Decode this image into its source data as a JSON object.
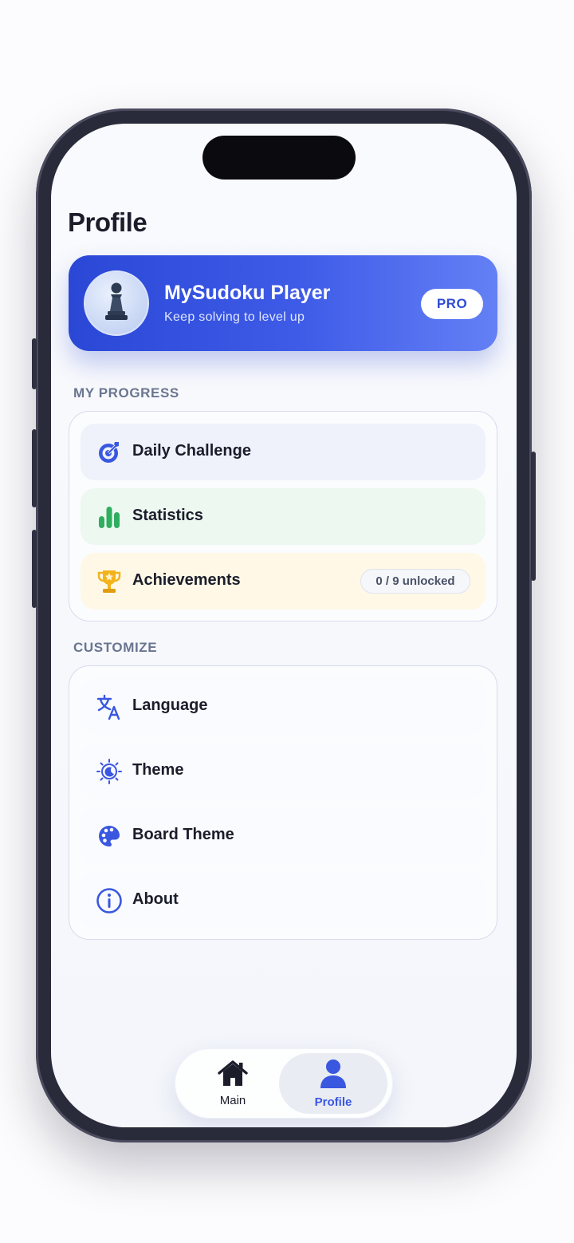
{
  "header": {
    "title": "Profile"
  },
  "profile": {
    "name": "MySudoku Player",
    "subtitle": "Keep solving to level up",
    "badge": "PRO",
    "avatar_icon": "chess-pawn-icon"
  },
  "progress": {
    "section_label": "MY PROGRESS",
    "items": [
      {
        "label": "Daily Challenge",
        "icon": "target-icon",
        "bg": "#eff2fb"
      },
      {
        "label": "Statistics",
        "icon": "bar-chart-icon",
        "bg": "#edf8f0"
      },
      {
        "label": "Achievements",
        "icon": "trophy-icon",
        "bg": "#fff8e6",
        "badge": "0 / 9 unlocked"
      }
    ]
  },
  "customize": {
    "section_label": "CUSTOMIZE",
    "items": [
      {
        "label": "Language",
        "icon": "translate-icon"
      },
      {
        "label": "Theme",
        "icon": "theme-moon-sun-icon"
      },
      {
        "label": "Board Theme",
        "icon": "palette-icon"
      },
      {
        "label": "About",
        "icon": "info-icon"
      }
    ]
  },
  "tabbar": {
    "tabs": [
      {
        "label": "Main",
        "icon": "home-icon",
        "active": false
      },
      {
        "label": "Profile",
        "icon": "user-icon",
        "active": true
      }
    ]
  },
  "colors": {
    "accent": "#3a57e0",
    "success": "#2fae5f",
    "trophy": "#f2b31c",
    "text": "#1b1d2b",
    "muted": "#6a7590"
  }
}
